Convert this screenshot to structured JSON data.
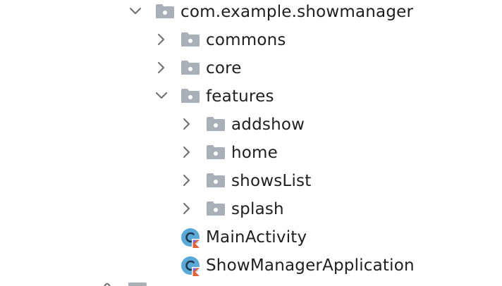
{
  "tree": {
    "package_root": "com.example.showmanager",
    "items": [
      {
        "label": "commons",
        "type": "folder",
        "expanded": false
      },
      {
        "label": "core",
        "type": "folder",
        "expanded": false
      },
      {
        "label": "features",
        "type": "folder",
        "expanded": true
      },
      {
        "label": "addshow",
        "type": "folder",
        "expanded": false
      },
      {
        "label": "home",
        "type": "folder",
        "expanded": false
      },
      {
        "label": "showsList",
        "type": "folder",
        "expanded": false
      },
      {
        "label": "splash",
        "type": "folder",
        "expanded": false
      },
      {
        "label": "MainActivity",
        "type": "kotlin-class"
      },
      {
        "label": "ShowManagerApplication",
        "type": "kotlin-class"
      }
    ]
  },
  "icons": {
    "chevron_expanded": "chevron-down-icon",
    "chevron_collapsed": "chevron-right-icon",
    "package": "package-folder-icon",
    "kotlin_class": "kotlin-class-icon"
  },
  "colors": {
    "folder": "#a9b0b8",
    "chevron": "#6e6e6e",
    "text": "#1f1f1f",
    "kotlin_circle": "#5aa9d6",
    "kotlin_accent": "#e0623a"
  }
}
